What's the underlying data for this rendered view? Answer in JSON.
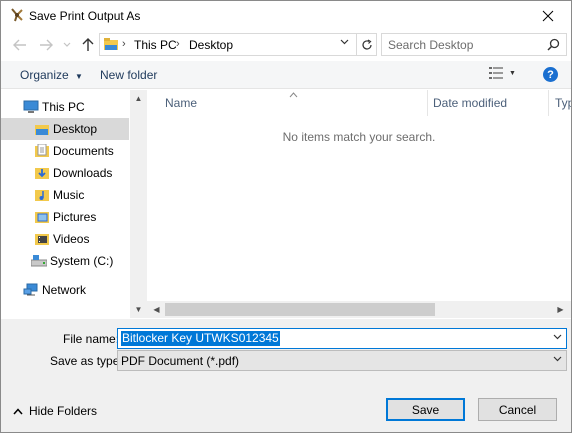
{
  "window": {
    "title": "Save Print Output As"
  },
  "nav": {
    "breadcrumb": [
      "This PC",
      "Desktop"
    ],
    "search_placeholder": "Search Desktop"
  },
  "toolbar": {
    "organize": "Organize",
    "new_folder": "New folder"
  },
  "tree": {
    "items": [
      {
        "label": "This PC",
        "icon": "computer-icon"
      },
      {
        "label": "Desktop",
        "icon": "desktop-folder-icon",
        "selected": true
      },
      {
        "label": "Documents",
        "icon": "documents-folder-icon"
      },
      {
        "label": "Downloads",
        "icon": "downloads-folder-icon"
      },
      {
        "label": "Music",
        "icon": "music-folder-icon"
      },
      {
        "label": "Pictures",
        "icon": "pictures-folder-icon"
      },
      {
        "label": "Videos",
        "icon": "videos-folder-icon"
      },
      {
        "label": "System (C:)",
        "icon": "drive-icon"
      },
      {
        "label": "Network",
        "icon": "network-icon"
      }
    ]
  },
  "list": {
    "columns": [
      "Name",
      "Date modified",
      "Typ"
    ],
    "empty_message": "No items match your search."
  },
  "form": {
    "file_name_label": "File name:",
    "file_name_value": "Bitlocker Key UTWKS012345",
    "save_type_label": "Save as type:",
    "save_type_value": "PDF Document (*.pdf)"
  },
  "footer": {
    "hide_folders": "Hide Folders",
    "save": "Save",
    "cancel": "Cancel"
  },
  "colors": {
    "accent": "#0078d7",
    "selection": "#d9d9d9",
    "panel": "#f0f0f0"
  }
}
